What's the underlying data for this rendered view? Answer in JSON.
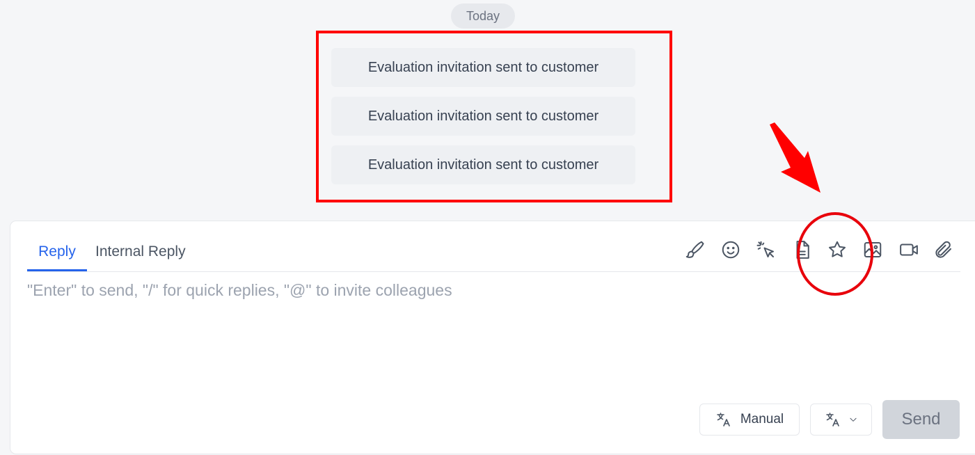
{
  "timeline": {
    "date_label": "Today",
    "events": [
      "Evaluation invitation sent to customer",
      "Evaluation invitation sent to customer",
      "Evaluation invitation sent to customer"
    ]
  },
  "composer": {
    "tabs": [
      {
        "label": "Reply",
        "active": true
      },
      {
        "label": "Internal Reply",
        "active": false
      }
    ],
    "toolbar_icons": [
      "brush-icon",
      "emoji-icon",
      "click-icon",
      "document-icon",
      "star-icon",
      "image-icon",
      "video-icon",
      "attachment-icon"
    ],
    "placeholder": "\"Enter\" to send, \"/\" for quick replies, \"@\" to invite colleagues",
    "value": "",
    "translate_mode_label": "Manual",
    "send_label": "Send"
  },
  "colors": {
    "accent": "#2563eb",
    "annotation": "#ff0000",
    "send_disabled_bg": "#d1d5db"
  }
}
